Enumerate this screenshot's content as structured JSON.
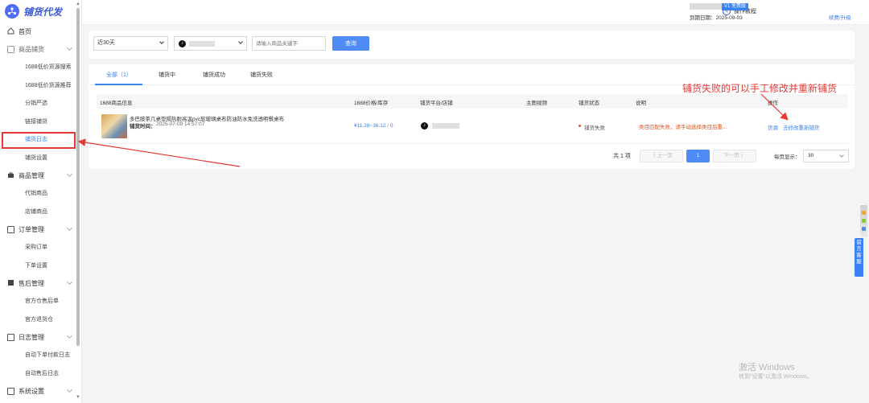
{
  "app": {
    "name": "铺货代发"
  },
  "sidebar": {
    "home": "首页",
    "groups": [
      {
        "label": "商品铺货",
        "items": [
          "1688低价货源搜索",
          "1688低价货源推荐",
          "分销严选",
          "链接铺货",
          "铺货日志",
          "铺货设置"
        ]
      },
      {
        "label": "商品管理",
        "items": [
          "代销商品",
          "店铺商品"
        ]
      },
      {
        "label": "订单管理",
        "items": [
          "采购订单",
          "下单设置"
        ]
      },
      {
        "label": "售后管理",
        "items": [
          "官方仓售后单",
          "官方退货仓"
        ]
      },
      {
        "label": "日志管理",
        "items": [
          "自动下单付款日志",
          "自动售后日志"
        ]
      },
      {
        "label": "系统设置",
        "items": []
      }
    ],
    "active_item": "铺货日志"
  },
  "header": {
    "tutorial": "操作教程",
    "plan_badge": "V1 免费版",
    "expire_label": "到期日期：",
    "expire_date": "2025-09-03",
    "renew": "续费/升级"
  },
  "filters": {
    "range": "近30天",
    "search_placeholder": "请输入商品关键字",
    "query_button": "查询"
  },
  "tabs": [
    "全部（1）",
    "铺货中",
    "铺货成功",
    "铺货失败"
  ],
  "table": {
    "headers": [
      "1688商品信息",
      "1688价格/库存",
      "铺货平台/店铺",
      "主图视频",
      "铺货状态",
      "说明",
      "操作"
    ],
    "rows": [
      {
        "name": "多巴胺茶几桌垫隔热耐高温pvc软玻璃桌布防油防水免洗透明餐桌布",
        "time_label": "铺货时间：",
        "time": "2025-07-09 14:57:07",
        "price": "¥11.28~36.12",
        "stock_sep": " / ",
        "stock": "0",
        "status": "铺货失败",
        "desc": "类目匹配失败，请手动选择类目后重...",
        "actions": [
          "货源",
          "去修改重新铺货"
        ]
      }
    ]
  },
  "pagination": {
    "total": "共 1 项",
    "prev": "〈 上一页",
    "current": "1",
    "next": "下一页 〉",
    "per_page_label": "每页显示：",
    "per_page": "30"
  },
  "annotation": "铺货失败的可以手工修改并重新铺货",
  "side_widget": {
    "contact": "留言客服"
  },
  "watermark": {
    "line1": "激活 Windows",
    "line2": "转到\"设置\"以激活 Windows。"
  },
  "colors": {
    "accent": "#3b82f6",
    "annotation": "#e53935",
    "status_failed": "#e8531d"
  }
}
